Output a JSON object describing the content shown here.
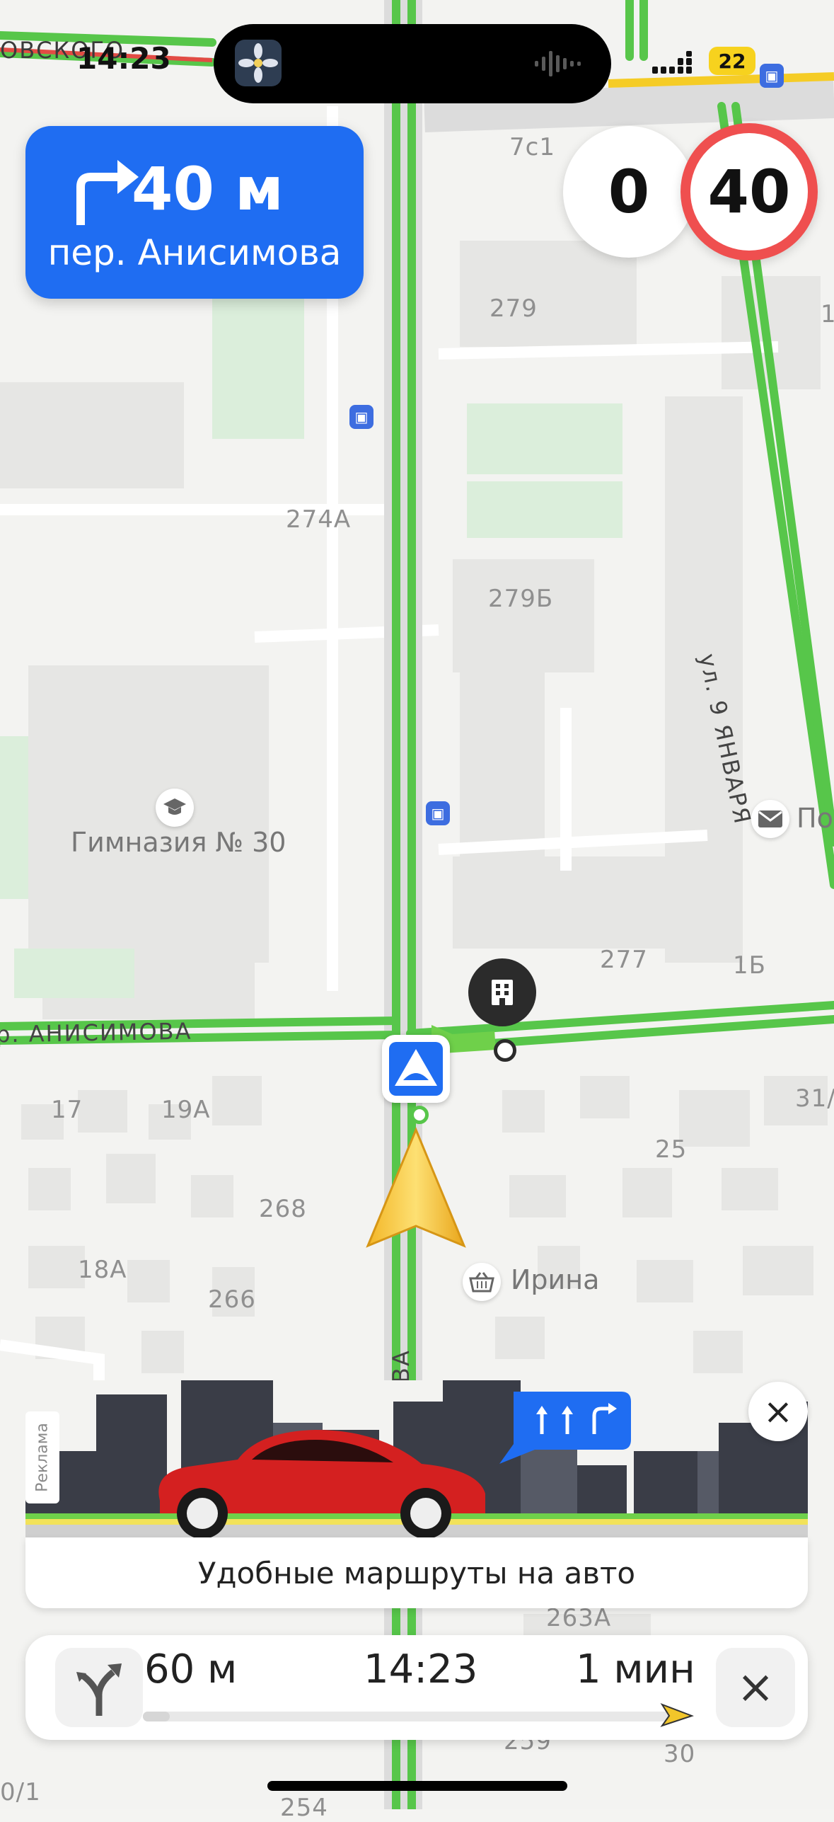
{
  "status_bar": {
    "time": "14:23",
    "battery": "22"
  },
  "maneuver": {
    "distance": "40 м",
    "street": "пер. Анисимова",
    "icon": "turn-right-arrow-icon"
  },
  "speed": {
    "current": "0",
    "limit": "40"
  },
  "map": {
    "street_labels": {
      "top_left": "ОВСКОГО",
      "anisimova": "р. АНИСИМОВА",
      "yanvarya": "ул. 9 ЯНВАРЯ",
      "vertical": "ВА"
    },
    "buildings": [
      "7с1",
      "279",
      "274А",
      "279Б",
      "277",
      "1Б",
      "17",
      "19А",
      "25",
      "31/",
      "268",
      "18А",
      "266",
      "263А",
      "259",
      "30",
      "0/1",
      "254",
      "1"
    ],
    "pois": {
      "school": "Гимназия № 30",
      "shop": "Ирина",
      "post": "По"
    }
  },
  "ad": {
    "tag": "Реклама",
    "caption": "Удобные маршруты на авто",
    "close": "×"
  },
  "panel": {
    "distance": "60 м",
    "arrival": "14:23",
    "eta": "1 мин",
    "close": "×",
    "progress": 0.05
  },
  "colors": {
    "route_green": "#57c64a",
    "accent_blue": "#1f6df2",
    "speed_red": "#ef4f4f",
    "arrow_yellow": "#f6c531"
  }
}
